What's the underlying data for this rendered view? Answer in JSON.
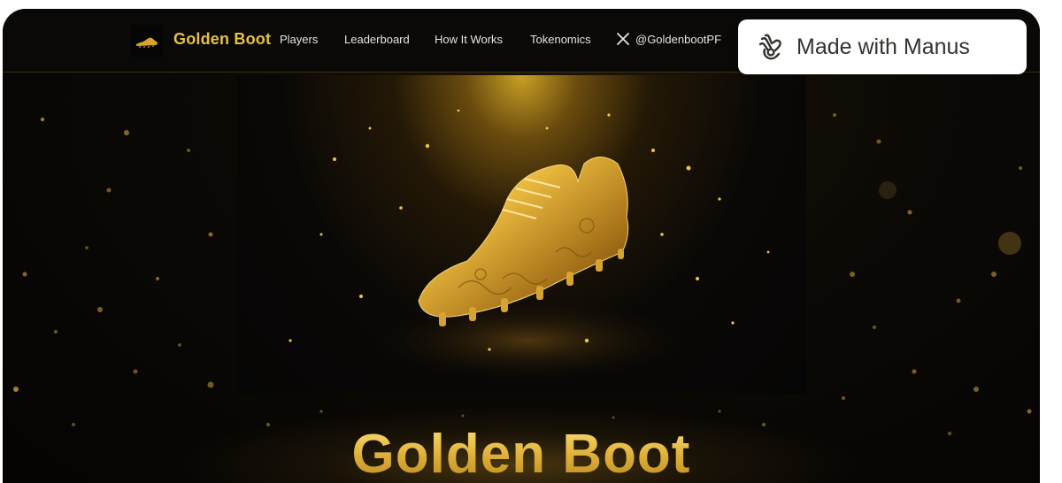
{
  "brand": {
    "name": "Golden Boot"
  },
  "nav": {
    "links": [
      "Players",
      "Leaderboard",
      "How It Works",
      "Tokenomics"
    ],
    "social_handle": "@GoldenbootPF"
  },
  "badge": {
    "label": "Made with Manus"
  },
  "hero": {
    "title": "Golden Boot"
  },
  "icons": {
    "logo": "golden-boot-logo",
    "social": "x-icon",
    "badge": "manus-hand-icon"
  },
  "colors": {
    "accent_gold": "#e7c046",
    "background": "#0b0905",
    "nav_text": "#e8e4da"
  }
}
